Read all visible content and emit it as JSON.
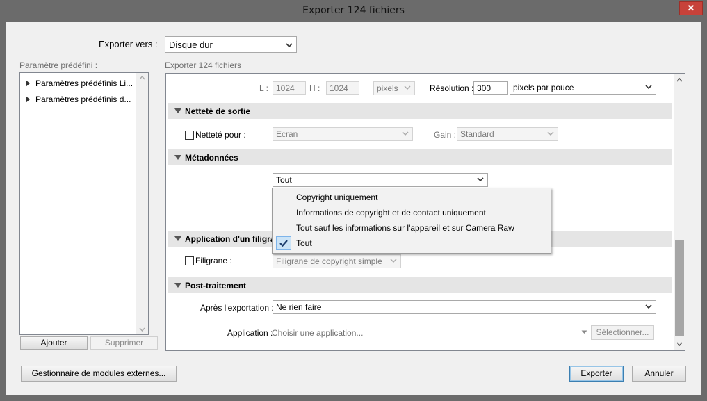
{
  "window": {
    "title": "Exporter 124 fichiers",
    "close_glyph": "✕"
  },
  "export_to": {
    "label": "Exporter vers :",
    "value": "Disque dur"
  },
  "presets": {
    "label": "Paramètre prédéfini :",
    "items": [
      {
        "label": "Paramètres prédéfinis Li..."
      },
      {
        "label": "Paramètres prédéfinis d..."
      }
    ],
    "add_label": "Ajouter",
    "remove_label": "Supprimer"
  },
  "main": {
    "header": "Exporter 124 fichiers",
    "size": {
      "l_label": "L :",
      "l_value": "1024",
      "h_label": "H :",
      "h_value": "1024",
      "unit": "pixels",
      "resolution_label": "Résolution :",
      "resolution_value": "300",
      "resolution_unit": "pixels par pouce"
    },
    "sharpening": {
      "title": "Netteté de sortie",
      "checkbox_label": "Netteté pour :",
      "target": "Ecran",
      "gain_label": "Gain :",
      "gain_value": "Standard"
    },
    "metadata": {
      "title": "Métadonnées",
      "value": "Tout",
      "options": [
        {
          "label": "Copyright uniquement",
          "checked": false
        },
        {
          "label": "Informations de copyright et de contact uniquement",
          "checked": false
        },
        {
          "label": "Tout sauf les informations sur l'appareil et sur Camera Raw",
          "checked": false
        },
        {
          "label": "Tout",
          "checked": true
        }
      ]
    },
    "watermark": {
      "title": "Application d'un filigrane",
      "checkbox_label": "Filigrane :",
      "value": "Filigrane de copyright simple"
    },
    "post_processing": {
      "title": "Post-traitement",
      "after_export_label": "Après l'exportation :",
      "after_export_value": "Ne rien faire",
      "application_label": "Application :",
      "application_placeholder": "Choisir une application...",
      "select_label": "Sélectionner..."
    }
  },
  "footer": {
    "plugin_manager_label": "Gestionnaire de modules externes...",
    "export_label": "Exporter",
    "cancel_label": "Annuler"
  },
  "icons": {
    "preset_expand": "triangle-right-icon",
    "section_collapse": "triangle-down-icon",
    "dropdown": "chevron-down-icon",
    "check": "checkmark-icon",
    "close": "close-icon"
  }
}
